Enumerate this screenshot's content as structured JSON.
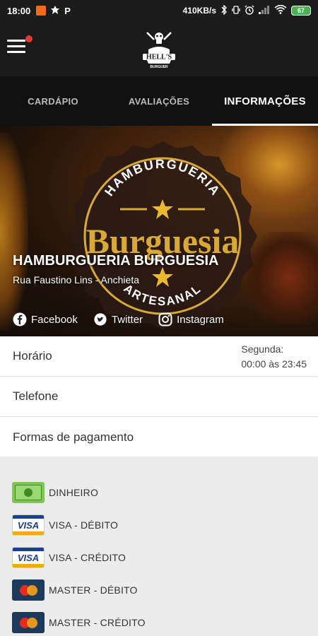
{
  "status_bar": {
    "time": "18:00",
    "net_speed": "410KB/s",
    "battery": "67"
  },
  "app": {
    "logo_text": "HELL'S",
    "logo_subtext": "BURGUER"
  },
  "tabs": [
    {
      "label": "CARDÁPIO",
      "active": false
    },
    {
      "label": "AVALIAÇÕES",
      "active": false
    },
    {
      "label": "INFORMAÇÕES",
      "active": true
    }
  ],
  "hero": {
    "badge_top": "HAMBURGUERIA",
    "badge_main": "Burguesia",
    "badge_bottom": "ARTESANAL",
    "title": "HAMBURGUERIA BURGUESIA",
    "address": "Rua Faustino Lins - Anchieta",
    "social": {
      "facebook": "Facebook",
      "twitter": "Twitter",
      "instagram": "Instagram"
    }
  },
  "info": {
    "hours_label": "Horário",
    "hours_day": "Segunda:",
    "hours_time": "00:00 às 23:45",
    "phone_label": "Telefone",
    "payments_label": "Formas de pagamento"
  },
  "payments": [
    {
      "label": "DINHEIRO",
      "icon": "cash-icon"
    },
    {
      "label": "VISA - DÉBITO",
      "icon": "visa-icon"
    },
    {
      "label": "VISA - CRÉDITO",
      "icon": "visa-icon"
    },
    {
      "label": "MASTER - DÉBITO",
      "icon": "mastercard-icon"
    },
    {
      "label": "MASTER - CRÉDITO",
      "icon": "mastercard-icon"
    }
  ],
  "colors": {
    "accent": "#ffffff",
    "badge_gold": "#d9a937",
    "mastercard_red": "#e62b1e",
    "mastercard_orange": "#f7a21b",
    "visa_blue": "#1a3f8e"
  }
}
